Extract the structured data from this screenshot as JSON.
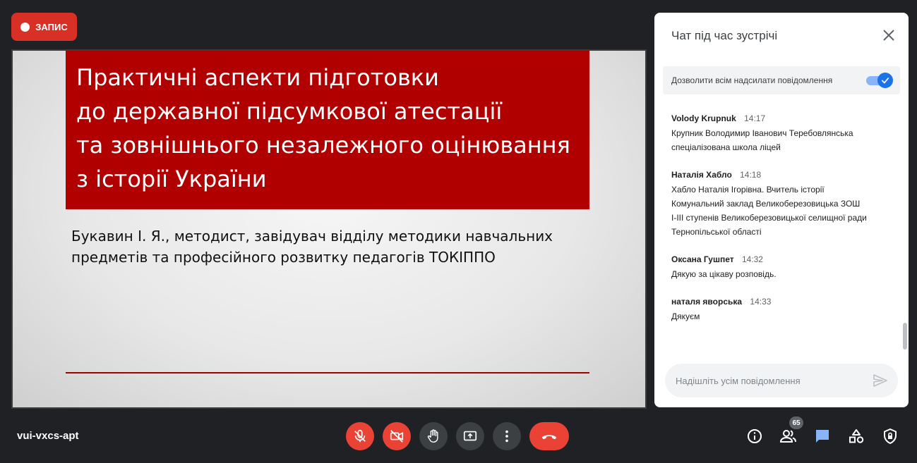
{
  "recording": {
    "label": "ЗАПИС"
  },
  "slide": {
    "title_lines": [
      "Практичні аспекти підготовки",
      "до державної підсумкової атестації",
      "та зовнішнього незалежного оцінювання",
      "з історії України"
    ],
    "author_lines": [
      "Букавин І. Я., методист, завідувач відділу методики навчальних",
      "предметів та професійного розвитку педагогів ТОКІППО"
    ]
  },
  "chat": {
    "title": "Чат під час зустрічі",
    "allow_all_label": "Дозволити всім надсилати повідомлення",
    "allow_all_enabled": true,
    "messages": [
      {
        "sender": "Volody Krupnuk",
        "time": "14:17",
        "text": [
          "Крупник Володимир Іванович Теребовлянська",
          "спеціалізована школа ліцей"
        ]
      },
      {
        "sender": "Наталія Хабло",
        "time": "14:18",
        "text": [
          "Хабло Наталія Ігорівна. Вчитель історії",
          "Комунальний заклад Великоберезовицька ЗОШ",
          "І-ІІІ ступенів Великоберезовицької селищної ради",
          "Тернопільської області"
        ]
      },
      {
        "sender": "Оксана Гушпет",
        "time": "14:32",
        "text": [
          "Дякую за цікаву розповідь."
        ]
      },
      {
        "sender": "наталя яворська",
        "time": "14:33",
        "text": [
          "Дякуєм"
        ]
      }
    ],
    "input_placeholder": "Надішліть усім повідомлення"
  },
  "footer": {
    "meeting_code": "vui-vxcs-apt",
    "participant_count": "65"
  },
  "colors": {
    "danger": "#ea4335",
    "slide_red": "#b00000",
    "accent": "#1a73e8",
    "chat_icon": "#8ab4f8"
  },
  "icons": [
    "record-dot-icon",
    "close-icon",
    "check-icon",
    "send-icon",
    "mic-off-icon",
    "camera-off-icon",
    "raise-hand-icon",
    "present-icon",
    "more-vert-icon",
    "end-call-icon",
    "info-icon",
    "people-icon",
    "chat-icon",
    "activities-icon",
    "host-controls-icon"
  ]
}
